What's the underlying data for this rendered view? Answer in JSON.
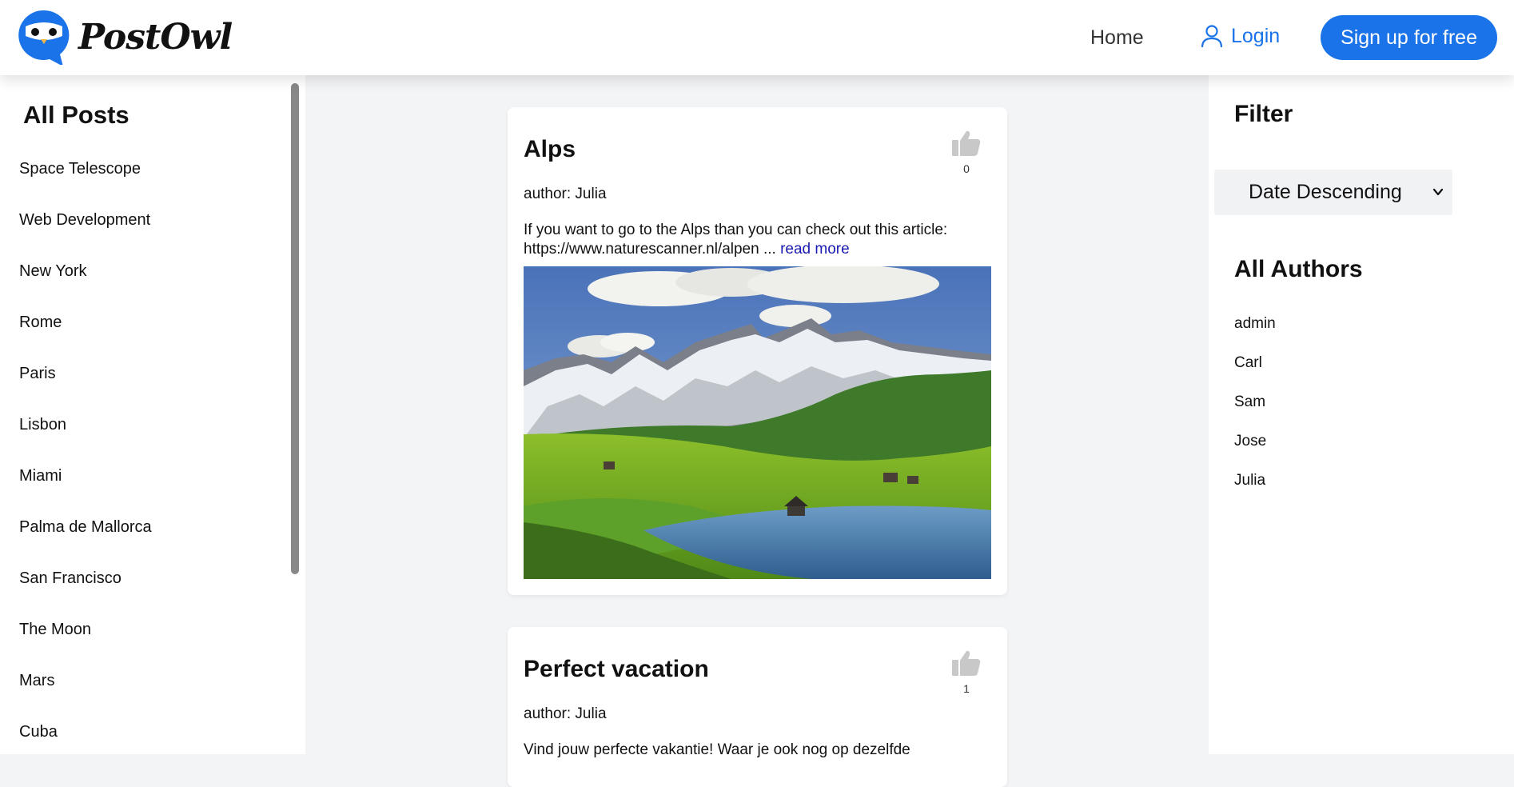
{
  "header": {
    "brand": "PostOwl",
    "home_label": "Home",
    "login_label": "Login",
    "signup_label": "Sign up for free"
  },
  "left_sidebar": {
    "title": "All Posts",
    "items": [
      "Space Telescope",
      "Web Development",
      "New York",
      "Rome",
      "Paris",
      "Lisbon",
      "Miami",
      "Palma de Mallorca",
      "San Francisco",
      "The Moon",
      "Mars",
      "Cuba"
    ]
  },
  "posts": [
    {
      "title": "Alps",
      "likes": "0",
      "author": "author: Julia",
      "excerpt": "If you want to go to the Alps than you can check out this article: https://www.naturescanner.nl/alpen ... ",
      "read_more": "read more"
    },
    {
      "title": "Perfect vacation",
      "likes": "1",
      "author": "author: Julia",
      "excerpt": "Vind jouw perfecte vakantie! Waar je ook nog op dezelfde"
    }
  ],
  "right_sidebar": {
    "filter_title": "Filter",
    "sort_selected": "Date Descending",
    "authors_title": "All Authors",
    "authors": [
      "admin",
      "Carl",
      "Sam",
      "Jose",
      "Julia"
    ]
  },
  "colors": {
    "accent": "#1a73e8",
    "background": "#f3f4f6",
    "link": "#1a1ab0"
  },
  "icons": [
    "owl-logo-icon",
    "user-icon",
    "thumbs-up-icon",
    "chevron-down-icon"
  ]
}
